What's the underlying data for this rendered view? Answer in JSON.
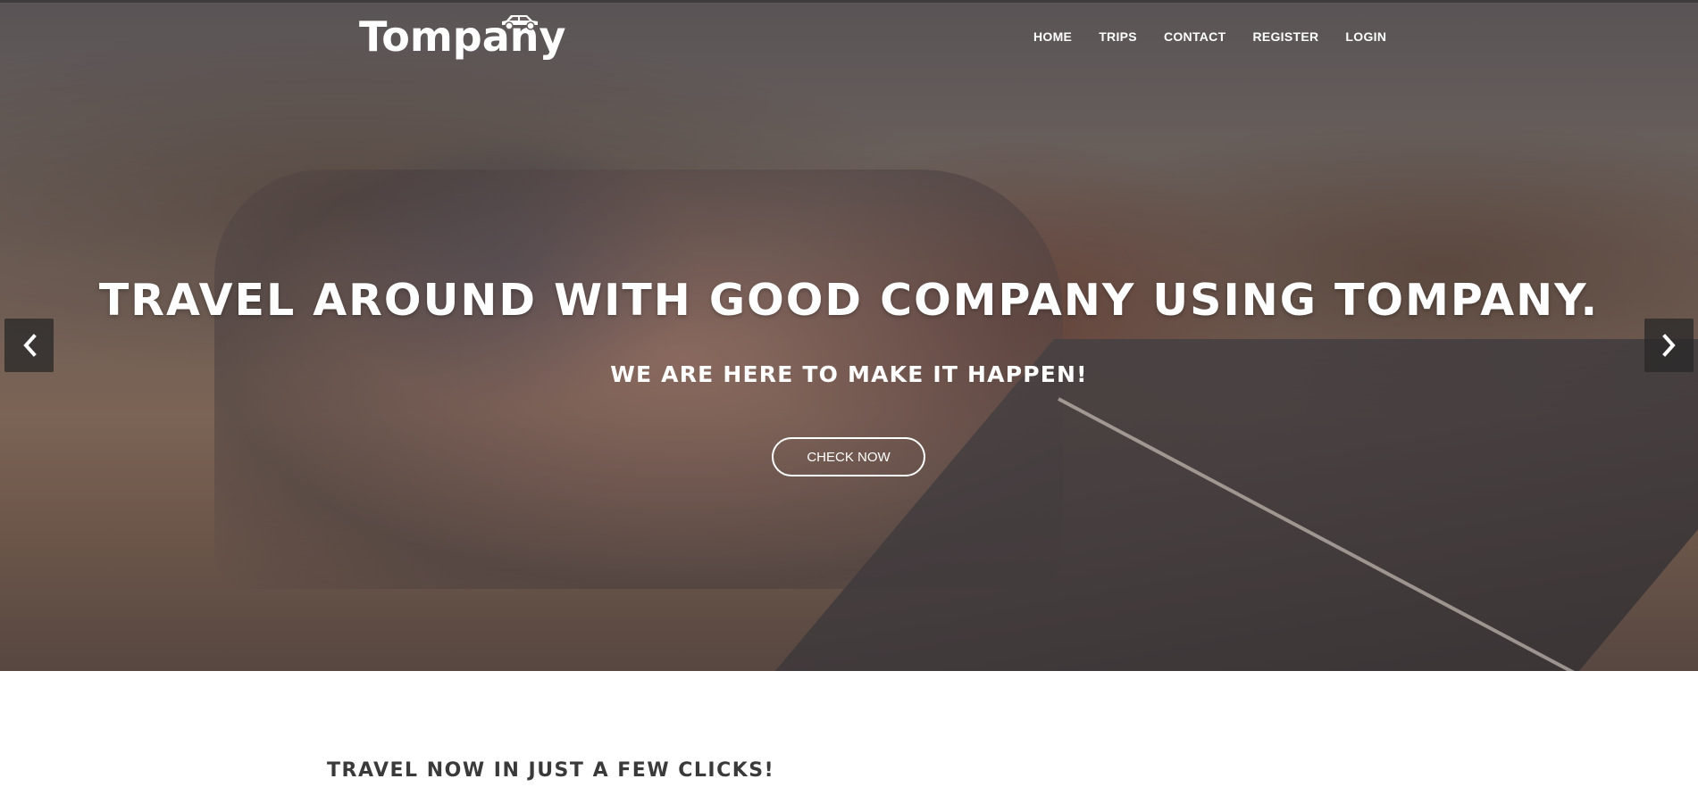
{
  "brand": {
    "logo_text": "Tompany",
    "logo_icon": "car-icon"
  },
  "nav": {
    "items": [
      {
        "label": "HOME"
      },
      {
        "label": "TRIPS"
      },
      {
        "label": "CONTACT"
      },
      {
        "label": "REGISTER"
      },
      {
        "label": "LOGIN"
      }
    ]
  },
  "hero": {
    "headline": "TRAVEL AROUND WITH GOOD COMPANY USING TOMPANY.",
    "subheadline": "WE ARE HERE TO MAKE IT HAPPEN!",
    "cta_label": "CHECK NOW",
    "prev_icon": "chevron-left-icon",
    "next_icon": "chevron-right-icon"
  },
  "content": {
    "section_title": "TRAVEL NOW IN JUST A FEW CLICKS!"
  },
  "colors": {
    "overlay": "#3c373a",
    "text_on_hero": "#ffffff",
    "arrow_bg": "#282828",
    "section_title": "#3a3a3a"
  }
}
